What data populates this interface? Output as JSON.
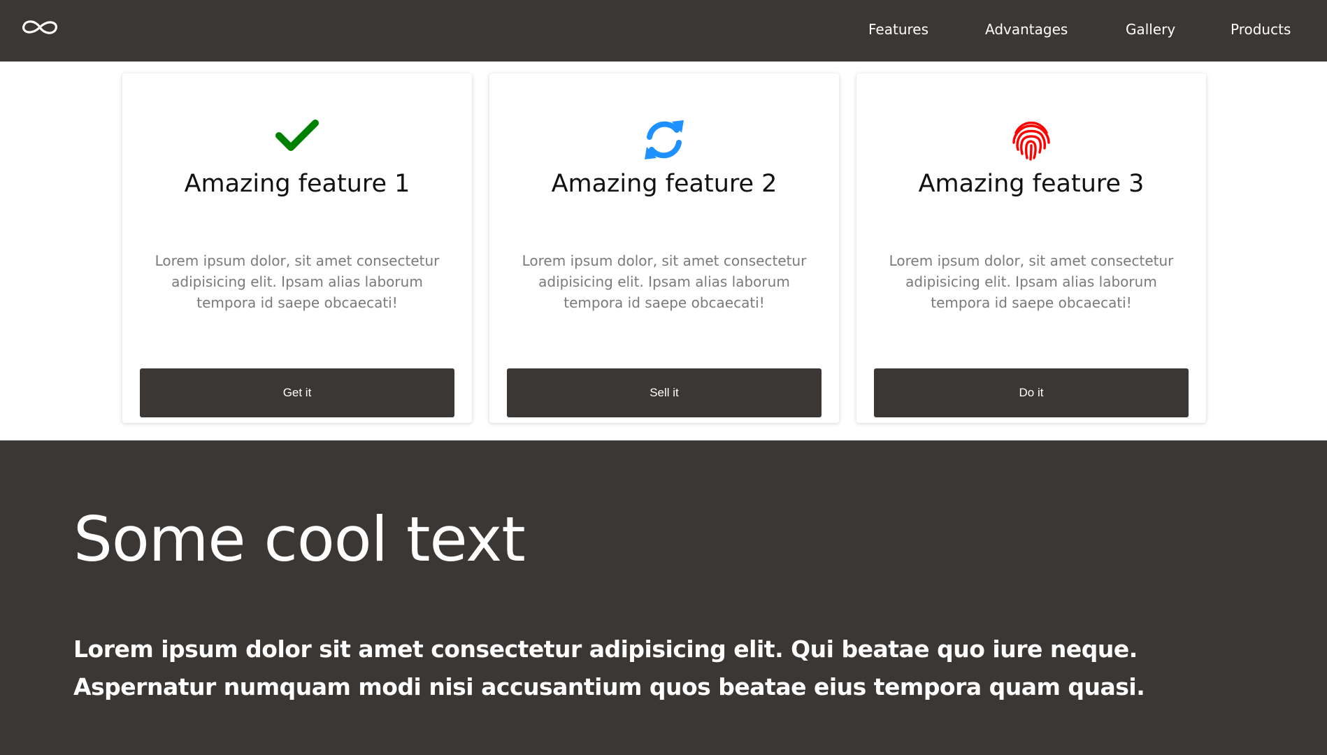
{
  "nav": {
    "logo_icon": "infinity-icon",
    "links": [
      "Features",
      "Advantages",
      "Gallery",
      "Products"
    ]
  },
  "cards": [
    {
      "icon": "check-icon",
      "icon_color": "#008000",
      "title": "Amazing feature 1",
      "text": "Lorem ipsum dolor, sit amet consectetur adipisicing elit. Ipsam alias laborum tempora id saepe obcaecati!",
      "button": "Get it"
    },
    {
      "icon": "refresh-icon",
      "icon_color": "#1e90ff",
      "title": "Amazing feature 2",
      "text": "Lorem ipsum dolor, sit amet consectetur adipisicing elit. Ipsam alias laborum tempora id saepe obcaecati!",
      "button": "Sell it"
    },
    {
      "icon": "fingerprint-icon",
      "icon_color": "#ff0000",
      "title": "Amazing feature 3",
      "text": "Lorem ipsum dolor, sit amet consectetur adipisicing elit. Ipsam alias laborum tempora id saepe obcaecati!",
      "button": "Do it"
    }
  ],
  "hero": {
    "title": "Some cool text",
    "text": "Lorem ipsum dolor sit amet consectetur adipisicing elit. Qui beatae quo iure neque. Aspernatur numquam modi nisi accusantium quos beatae eius tempora quam quasi."
  },
  "colors": {
    "dark_background": "#3b3735",
    "text_gray": "#7a7a7a"
  }
}
